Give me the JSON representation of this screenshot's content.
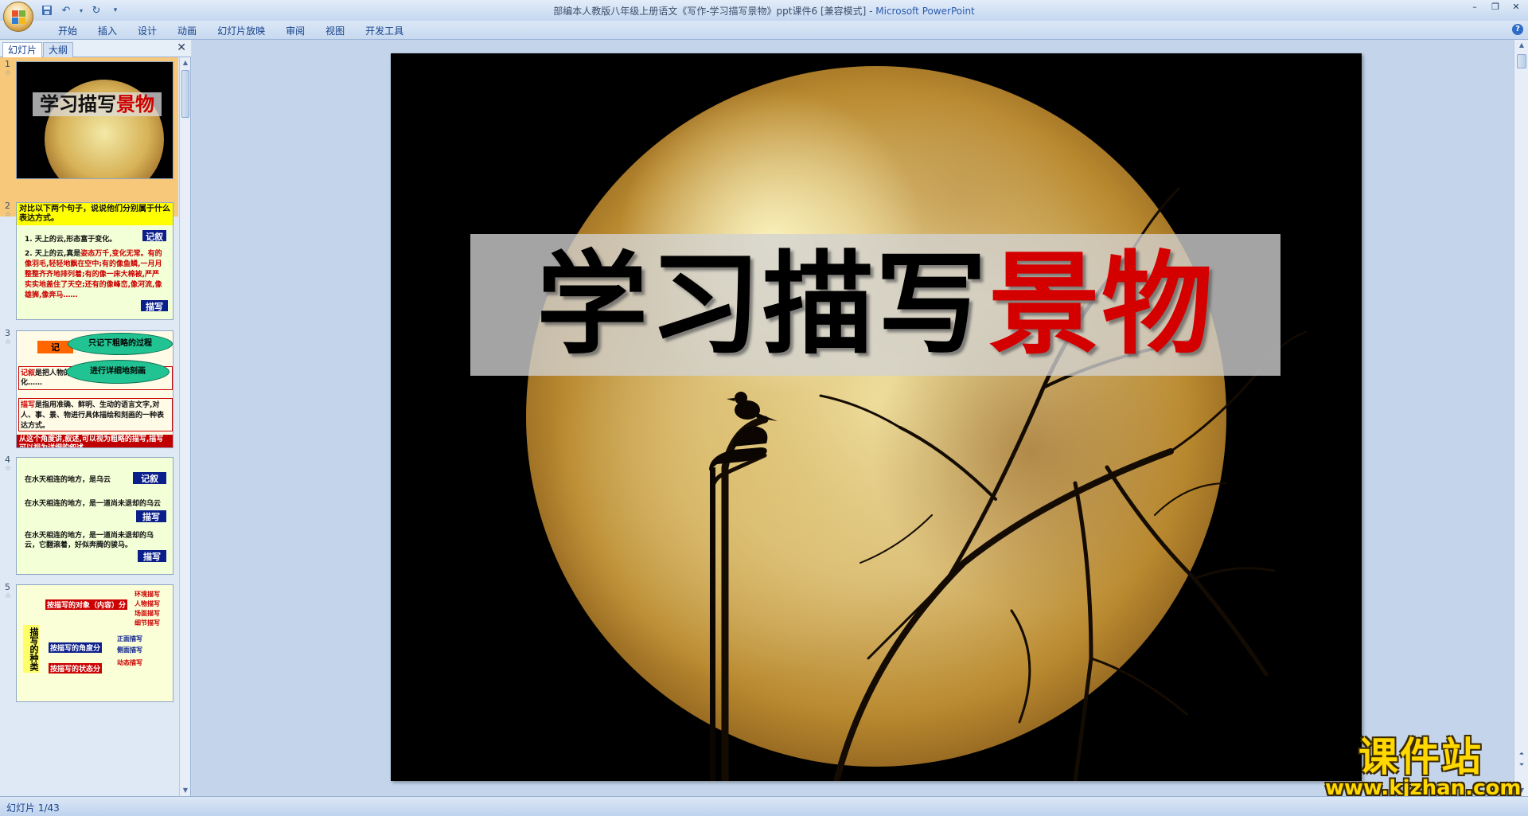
{
  "window": {
    "title_doc": "部编本人教版八年级上册语文《写作-学习描写景物》ppt课件6 [兼容模式] - ",
    "title_app": "Microsoft PowerPoint"
  },
  "qat": {
    "save_icon": "save-icon",
    "undo_icon": "undo-icon",
    "redo_icon": "redo-icon",
    "customize_icon": "customize-icon"
  },
  "ribbon": {
    "tabs": [
      "开始",
      "插入",
      "设计",
      "动画",
      "幻灯片放映",
      "审阅",
      "视图",
      "开发工具"
    ]
  },
  "left_pane": {
    "tabs": [
      "幻灯片",
      "大纲"
    ],
    "slides": [
      {
        "num": "1",
        "title_black": "学习描写",
        "title_red": "景物"
      },
      {
        "num": "2",
        "header": "对比以下两个句子，说说他们分别属于什么表达方式。",
        "line1": "1. 天上的云,形态富于变化。",
        "tag1": "记叙",
        "line2_a": "2. 天上的云,真是",
        "line2_red": "姿态万千,变化无常。有的像羽毛,轻轻地飘在空中;有的像鱼鳞,一月月整整齐齐地排列着;有的像一床大棉被,严严实实地盖住了天空;还有的像峰峦,像河流,像雄狮,像奔马……",
        "tag2": "描写"
      },
      {
        "num": "3",
        "orange": "记",
        "bubble1": "只记下粗略的过程",
        "bubble2": "进行详细地刻画",
        "box1_red": "记叙",
        "box1": "是把人物的经历和事物发生、发展、变化……",
        "box2_red": "描写",
        "box2": "是指用准确、鲜明、生动的语言文字,对人、事、景、物进行具体描绘和刻画的一种表达方式。",
        "redbar": "从这个角度讲,叙述,可以视为粗略的描写,描写可以视为详细的叙述。"
      },
      {
        "num": "4",
        "t1": "在水天相连的地方，是乌云",
        "tag1": "记叙",
        "t2": "在水天相连的地方，是一道尚未退却的乌云",
        "tag2": "描写",
        "t3": "在水天相连的地方，是一道尚未退却的乌云，它翻滚着，好似奔腾的骏马。",
        "tag3": "描写"
      },
      {
        "num": "5",
        "side": "描写的种类",
        "lbl1": "按描写的对象（内容）分",
        "subs1": [
          "环境描写",
          "人物描写",
          "场面描写",
          "细节描写"
        ],
        "lbl2": "按描写的角度分",
        "subs2": [
          "正面描写",
          "侧面描写"
        ],
        "lbl3": "按描写的状态分",
        "subs3": [
          "动态描写"
        ]
      }
    ]
  },
  "slide": {
    "title_black": "学习描写",
    "title_red": "景物"
  },
  "watermark": {
    "cn": "课件站",
    "url": "www.kjzhan.com"
  },
  "status": {
    "slide_counter": "幻灯片 1/43"
  },
  "colors": {
    "accent_red": "#d40000",
    "ribbon_blue": "#15428b",
    "thumb_selected": "#f7c87a"
  }
}
